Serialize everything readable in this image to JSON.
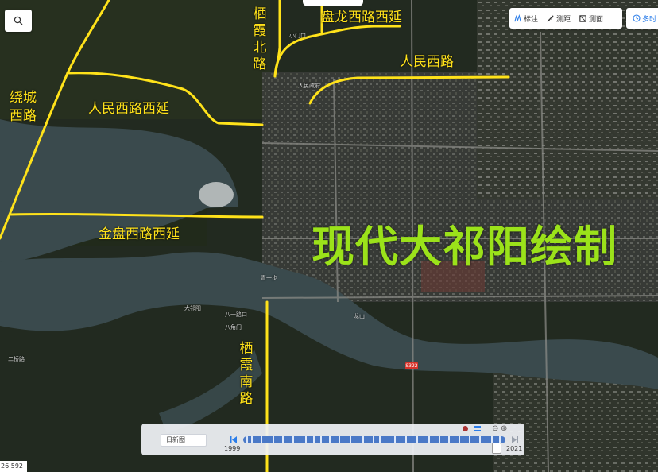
{
  "map": {
    "roads": [
      {
        "id": "panlong-west-ext",
        "label": "盘龙西路西延",
        "vertical": false
      },
      {
        "id": "qixia-north",
        "label": "栖霞北路",
        "vertical": true
      },
      {
        "id": "renmin-west",
        "label": "人民西路",
        "vertical": false
      },
      {
        "id": "raocheng-west",
        "label": "绕城\n西路",
        "vertical": false
      },
      {
        "id": "renmin-west-ext",
        "label": "人民西路西延",
        "vertical": false
      },
      {
        "id": "jinpan-west-ext",
        "label": "金盘西路西延",
        "vertical": false
      },
      {
        "id": "qixia-south",
        "label": "栖霞南路",
        "vertical": true
      }
    ],
    "watermark": "现代大祁阳绘制",
    "road_sign": "S322",
    "places": [
      "人民政府",
      "龙山",
      "八一路口",
      "八角门",
      "大祁阳",
      "青一步",
      "二桥路",
      "小门口"
    ]
  },
  "ui": {
    "toolbar": {
      "tools": [
        {
          "label": "标注",
          "icon": "marker-icon"
        },
        {
          "label": "测距",
          "icon": "ruler-icon"
        },
        {
          "label": "测面",
          "icon": "area-icon"
        }
      ],
      "history_label": "多时"
    },
    "timeline": {
      "basemap": "日新图",
      "start_year": "1999",
      "end_year": "2021",
      "position_fraction": 0.97
    },
    "coordinate": "26.592"
  },
  "colors": {
    "road_lines": "#ffe21a",
    "watermark": "#9be21a",
    "water": "#3a4a4d",
    "land": "#232b22"
  }
}
